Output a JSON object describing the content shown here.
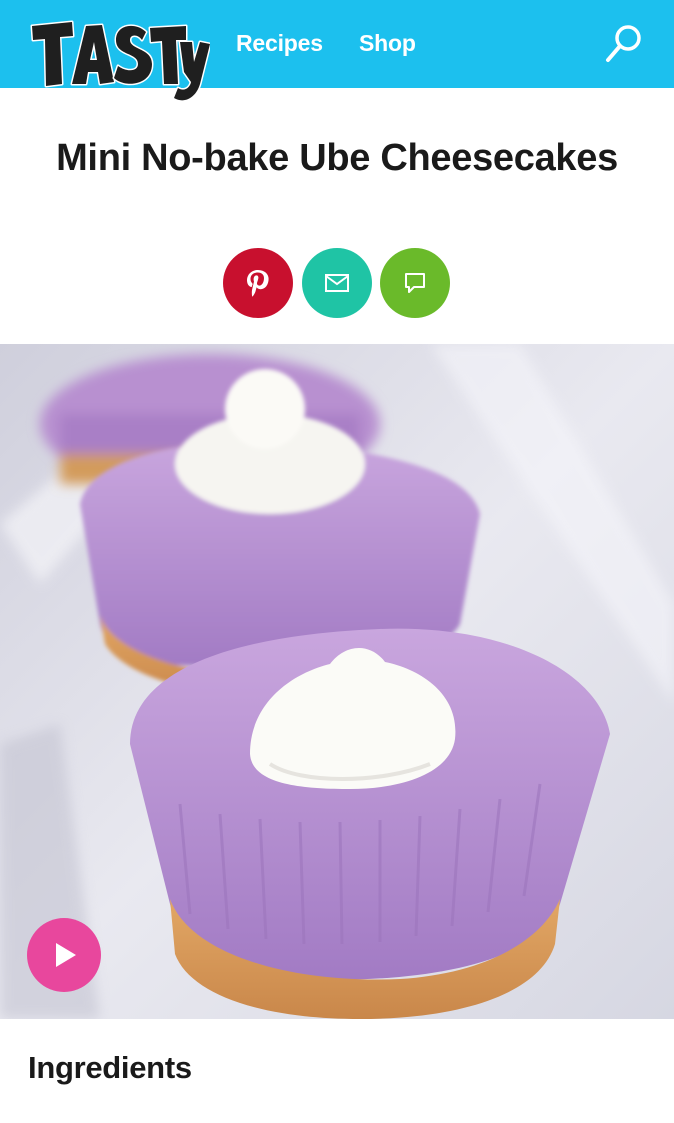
{
  "header": {
    "logo_text": "TASTY",
    "nav": [
      {
        "label": "Recipes"
      },
      {
        "label": "Shop"
      }
    ],
    "search_icon": "search-icon"
  },
  "recipe": {
    "title": "Mini No-bake Ube Cheesecakes",
    "share_buttons": [
      {
        "icon": "pinterest-icon",
        "color": "#c8102e"
      },
      {
        "icon": "email-icon",
        "color": "#1fc4a5"
      },
      {
        "icon": "comment-icon",
        "color": "#6aba2a"
      }
    ],
    "hero_image": "mini-ube-cheesecakes-photo",
    "play_icon": "play-icon",
    "ingredients_heading": "Ingredients"
  },
  "colors": {
    "brand_blue": "#1cc0ee",
    "play_pink": "#e8479d"
  }
}
